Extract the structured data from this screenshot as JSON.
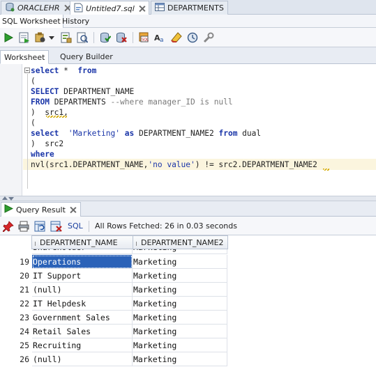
{
  "doc_tabs": [
    {
      "label": "ORACLEHR",
      "icon": "database-connection-icon"
    },
    {
      "label": "Untitled7.sql",
      "icon": "sql-file-icon",
      "active": true
    },
    {
      "label": "DEPARTMENTS",
      "icon": "table-icon"
    }
  ],
  "sub_tabs": [
    "SQL Worksheet",
    "History"
  ],
  "toolbar": {
    "icons": [
      "run-statement-icon",
      "run-script-icon",
      "autotrace-icon",
      "dropdown-arrow-icon",
      "explain-plan-icon",
      "sql-tuning-icon",
      "commit-icon",
      "rollback-icon",
      "sql-history-icon",
      "to-upper-lower-icon",
      "clear-icon",
      "unshared-sql-worksheet-icon",
      "tools-icon"
    ]
  },
  "worksheet_tabs": [
    "Worksheet",
    "Query Builder"
  ],
  "editor": {
    "lines": [
      "select *  from",
      "(",
      "SELECT DEPARTMENT_NAME",
      "FROM DEPARTMENTS --where manager_ID is null",
      ")  src1,",
      "(",
      "select  'Marketing' as DEPARTMENT_NAME2 from dual",
      ")  src2",
      "where",
      "nvl(src1.DEPARTMENT_NAME,'no value') != src2.DEPARTMENT_NAME2"
    ]
  },
  "result": {
    "tab_label": "Query Result",
    "close_icon": "close-icon",
    "toolbar_icons": [
      "pin-icon",
      "print-icon",
      "refresh-icon",
      "delete-icon"
    ],
    "sql_link": "SQL",
    "fetch_status": "All Rows Fetched: 26 in 0.03 seconds",
    "columns": [
      "DEPARTMENT_NAME",
      "DEPARTMENT_NAME2"
    ],
    "rows": [
      {
        "n": "19",
        "c1": "Operations",
        "c2": "Marketing",
        "selected": true
      },
      {
        "n": "20",
        "c1": "IT Support",
        "c2": "Marketing"
      },
      {
        "n": "21",
        "c1": "(null)",
        "c2": "Marketing"
      },
      {
        "n": "22",
        "c1": "IT Helpdesk",
        "c2": "Marketing"
      },
      {
        "n": "23",
        "c1": "Government Sales",
        "c2": "Marketing"
      },
      {
        "n": "24",
        "c1": "Retail Sales",
        "c2": "Marketing"
      },
      {
        "n": "25",
        "c1": "Recruiting",
        "c2": "Marketing"
      },
      {
        "n": "26",
        "c1": "(null)",
        "c2": "Marketing"
      }
    ]
  },
  "colors": {
    "keyword": "#1a35a8",
    "selection": "#2b62b8",
    "current_line": "#fbf5de"
  }
}
